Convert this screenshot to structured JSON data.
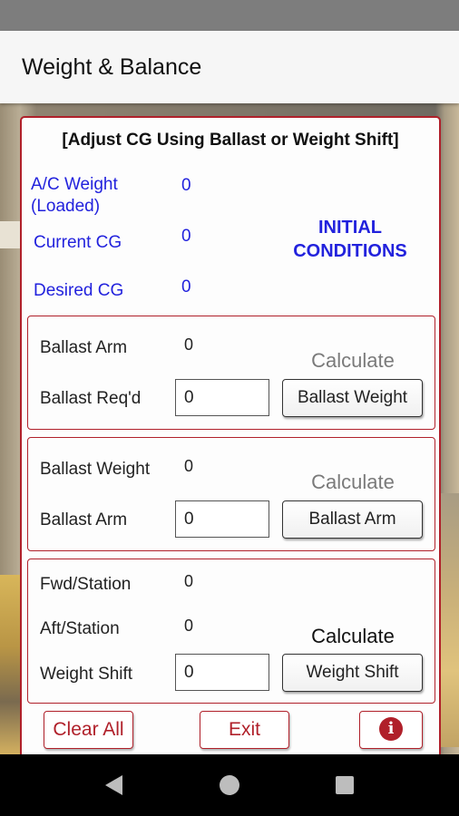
{
  "app": {
    "title": "Weight & Balance"
  },
  "header": "[Adjust CG Using Ballast or Weight Shift]",
  "initial": {
    "ac_weight_label_line1": "A/C Weight",
    "ac_weight_label_line2": "(Loaded)",
    "ac_weight_value": "0",
    "current_cg_label": "Current CG",
    "current_cg_value": "0",
    "desired_cg_label": "Desired CG",
    "desired_cg_value": "0",
    "title_line1": "INITIAL",
    "title_line2": "CONDITIONS"
  },
  "ballast_weight_section": {
    "arm_label": "Ballast Arm",
    "arm_value": "0",
    "req_label": "Ballast Req'd",
    "req_input_value": "0",
    "calculate_label": "Calculate",
    "button_label": "Ballast Weight"
  },
  "ballast_arm_section": {
    "weight_label": "Ballast Weight",
    "weight_value": "0",
    "arm_label": "Ballast Arm",
    "arm_input_value": "0",
    "calculate_label": "Calculate",
    "button_label": "Ballast Arm"
  },
  "weight_shift_section": {
    "fwd_label": "Fwd/Station",
    "fwd_value": "0",
    "aft_label": "Aft/Station",
    "aft_value": "0",
    "shift_label": "Weight Shift",
    "shift_input_value": "0",
    "calculate_label": "Calculate",
    "button_label": "Weight Shift"
  },
  "footer": {
    "clear_label": "Clear All",
    "exit_label": "Exit",
    "info_icon": "i"
  },
  "colors": {
    "accent": "#b0202a",
    "blue_text": "#2222dd"
  }
}
